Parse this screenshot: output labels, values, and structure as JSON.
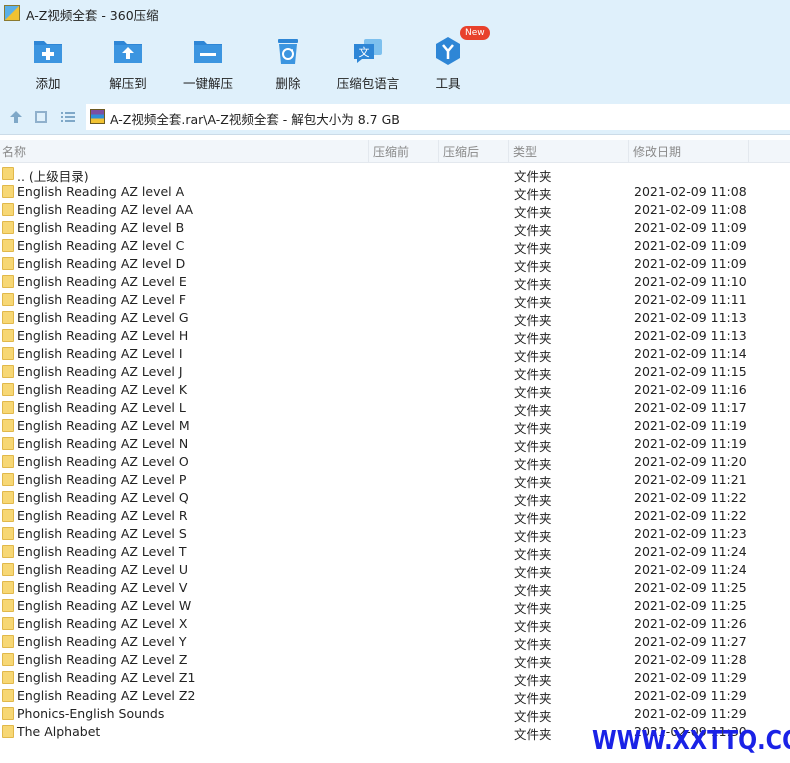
{
  "window": {
    "title": "A-Z视频全套 - 360压缩"
  },
  "toolbar": {
    "items": [
      {
        "label": "添加",
        "icon": "add-icon"
      },
      {
        "label": "解压到",
        "icon": "extract-to-icon"
      },
      {
        "label": "一键解压",
        "icon": "one-click-extract-icon"
      },
      {
        "label": "删除",
        "icon": "recycle-bin-icon"
      },
      {
        "label": "压缩包语言",
        "icon": "archive-language-icon"
      },
      {
        "label": "工具",
        "icon": "tools-icon",
        "badge": "New"
      }
    ]
  },
  "pathbar": {
    "path": "A-Z视频全套.rar\\A-Z视频全套 - 解包大小为 8.7 GB"
  },
  "columns": {
    "name": "名称",
    "compressed_before": "压缩前",
    "compressed_after": "压缩后",
    "type": "类型",
    "modified": "修改日期"
  },
  "rows": [
    {
      "name": ".. (上级目录)",
      "type": "文件夹",
      "date": ""
    },
    {
      "name": "English Reading AZ level A",
      "type": "文件夹",
      "date": "2021-02-09 11:08"
    },
    {
      "name": "English Reading AZ level AA",
      "type": "文件夹",
      "date": "2021-02-09 11:08"
    },
    {
      "name": "English Reading AZ level B",
      "type": "文件夹",
      "date": "2021-02-09 11:09"
    },
    {
      "name": "English Reading AZ level C",
      "type": "文件夹",
      "date": "2021-02-09 11:09"
    },
    {
      "name": "English Reading AZ level D",
      "type": "文件夹",
      "date": "2021-02-09 11:09"
    },
    {
      "name": "English Reading AZ Level E",
      "type": "文件夹",
      "date": "2021-02-09 11:10"
    },
    {
      "name": "English Reading AZ Level F",
      "type": "文件夹",
      "date": "2021-02-09 11:11"
    },
    {
      "name": "English Reading AZ Level G",
      "type": "文件夹",
      "date": "2021-02-09 11:13"
    },
    {
      "name": "English Reading AZ Level H",
      "type": "文件夹",
      "date": "2021-02-09 11:13"
    },
    {
      "name": "English Reading AZ Level I",
      "type": "文件夹",
      "date": "2021-02-09 11:14"
    },
    {
      "name": "English Reading AZ Level J",
      "type": "文件夹",
      "date": "2021-02-09 11:15"
    },
    {
      "name": "English Reading AZ Level K",
      "type": "文件夹",
      "date": "2021-02-09 11:16"
    },
    {
      "name": "English Reading AZ Level L",
      "type": "文件夹",
      "date": "2021-02-09 11:17"
    },
    {
      "name": "English Reading AZ Level M",
      "type": "文件夹",
      "date": "2021-02-09 11:19"
    },
    {
      "name": "English Reading AZ Level N",
      "type": "文件夹",
      "date": "2021-02-09 11:19"
    },
    {
      "name": "English Reading AZ Level O",
      "type": "文件夹",
      "date": "2021-02-09 11:20"
    },
    {
      "name": "English Reading AZ Level P",
      "type": "文件夹",
      "date": "2021-02-09 11:21"
    },
    {
      "name": "English Reading AZ Level Q",
      "type": "文件夹",
      "date": "2021-02-09 11:22"
    },
    {
      "name": "English Reading AZ Level R",
      "type": "文件夹",
      "date": "2021-02-09 11:22"
    },
    {
      "name": "English Reading AZ Level S",
      "type": "文件夹",
      "date": "2021-02-09 11:23"
    },
    {
      "name": "English Reading AZ Level T",
      "type": "文件夹",
      "date": "2021-02-09 11:24"
    },
    {
      "name": "English Reading AZ Level U",
      "type": "文件夹",
      "date": "2021-02-09 11:24"
    },
    {
      "name": "English Reading AZ Level V",
      "type": "文件夹",
      "date": "2021-02-09 11:25"
    },
    {
      "name": "English Reading AZ Level W",
      "type": "文件夹",
      "date": "2021-02-09 11:25"
    },
    {
      "name": "English Reading AZ Level X",
      "type": "文件夹",
      "date": "2021-02-09 11:26"
    },
    {
      "name": "English Reading AZ Level Y",
      "type": "文件夹",
      "date": "2021-02-09 11:27"
    },
    {
      "name": "English Reading AZ Level Z",
      "type": "文件夹",
      "date": "2021-02-09 11:28"
    },
    {
      "name": "English Reading AZ Level Z1",
      "type": "文件夹",
      "date": "2021-02-09 11:29"
    },
    {
      "name": "English Reading AZ Level Z2",
      "type": "文件夹",
      "date": "2021-02-09 11:29"
    },
    {
      "name": "Phonics-English Sounds",
      "type": "文件夹",
      "date": "2021-02-09 11:29"
    },
    {
      "name": "The Alphabet",
      "type": "文件夹",
      "date": "2021-02-09 11:30"
    }
  ],
  "watermark": "WWW.XXTTQ.COM",
  "colors": {
    "accent": "#2e86d6",
    "chrome": "#dff0fb",
    "folder": "#f7d774",
    "badge": "#e8412c",
    "watermark": "#1a22e6"
  }
}
